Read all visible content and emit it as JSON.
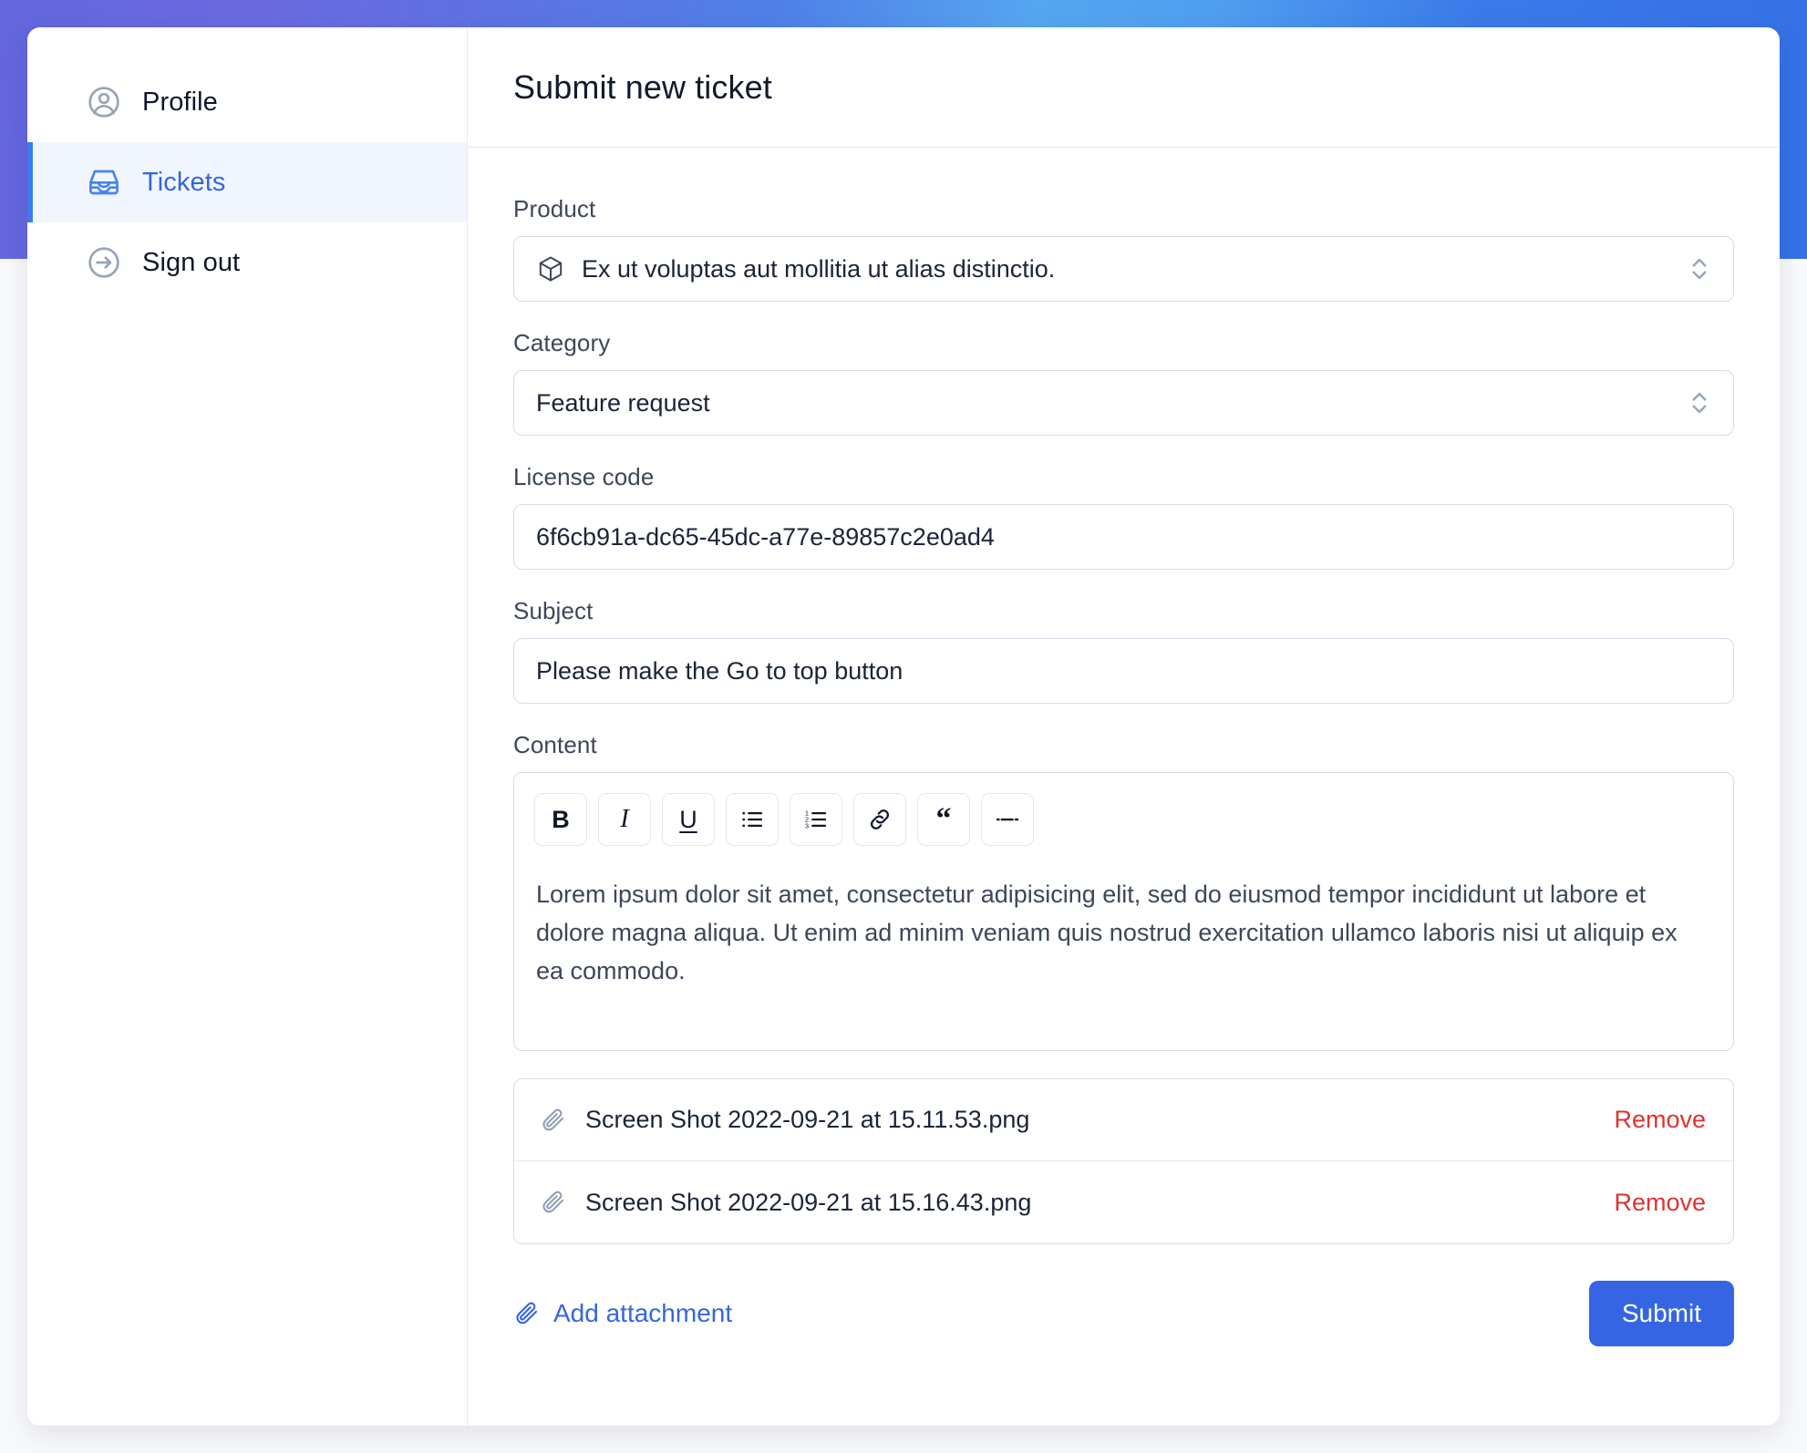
{
  "theme": {
    "accent_blue": "#3665e4",
    "active_nav_blue": "#3565e0",
    "danger_red": "#e03131",
    "gradient_left": "#6366dd",
    "gradient_right": "#3470e6",
    "page_background": "#f7f8fa"
  },
  "sidebar": {
    "items": [
      {
        "label": "Profile",
        "icon": "user-circle-icon",
        "active": false
      },
      {
        "label": "Tickets",
        "icon": "inbox-icon",
        "active": true
      },
      {
        "label": "Sign out",
        "icon": "arrow-right-circle-icon",
        "active": false
      }
    ]
  },
  "header": {
    "title": "Submit new ticket"
  },
  "form": {
    "product": {
      "label": "Product",
      "value": "Ex ut voluptas aut mollitia ut alias distinctio.",
      "icon": "cube-icon",
      "control": "select"
    },
    "category": {
      "label": "Category",
      "value": "Feature request",
      "control": "select"
    },
    "license_code": {
      "label": "License code",
      "value": "6f6cb91a-dc65-45dc-a77e-89857c2e0ad4",
      "placeholder": "",
      "control": "text"
    },
    "subject": {
      "label": "Subject",
      "value": "Please make the Go to top button",
      "placeholder": "",
      "control": "text"
    },
    "content": {
      "label": "Content",
      "body": "Lorem ipsum dolor sit amet, consectetur adipisicing elit, sed do eiusmod tempor incididunt ut labore et dolore magna aliqua. Ut enim ad minim veniam quis nostrud exercitation ullamco laboris nisi ut aliquip ex ea commodo.",
      "toolbar": [
        {
          "name": "bold-button",
          "glyph": "B",
          "style": "bold"
        },
        {
          "name": "italic-button",
          "glyph": "I",
          "style": "italic"
        },
        {
          "name": "underline-button",
          "glyph": "U",
          "style": "underline"
        },
        {
          "name": "bullet-list-button",
          "glyph": "",
          "style": "icon-bullet-list"
        },
        {
          "name": "numbered-list-button",
          "glyph": "",
          "style": "icon-numbered-list"
        },
        {
          "name": "link-button",
          "glyph": "",
          "style": "icon-link"
        },
        {
          "name": "blockquote-button",
          "glyph": "“",
          "style": "quote"
        },
        {
          "name": "horizontal-rule-button",
          "glyph": "",
          "style": "icon-hr"
        }
      ]
    }
  },
  "attachments": {
    "items": [
      {
        "filename": "Screen Shot 2022-09-21 at 15.11.53.png",
        "remove_label": "Remove"
      },
      {
        "filename": "Screen Shot 2022-09-21 at 15.16.43.png",
        "remove_label": "Remove"
      }
    ],
    "add_label": "Add attachment"
  },
  "actions": {
    "submit_label": "Submit"
  }
}
